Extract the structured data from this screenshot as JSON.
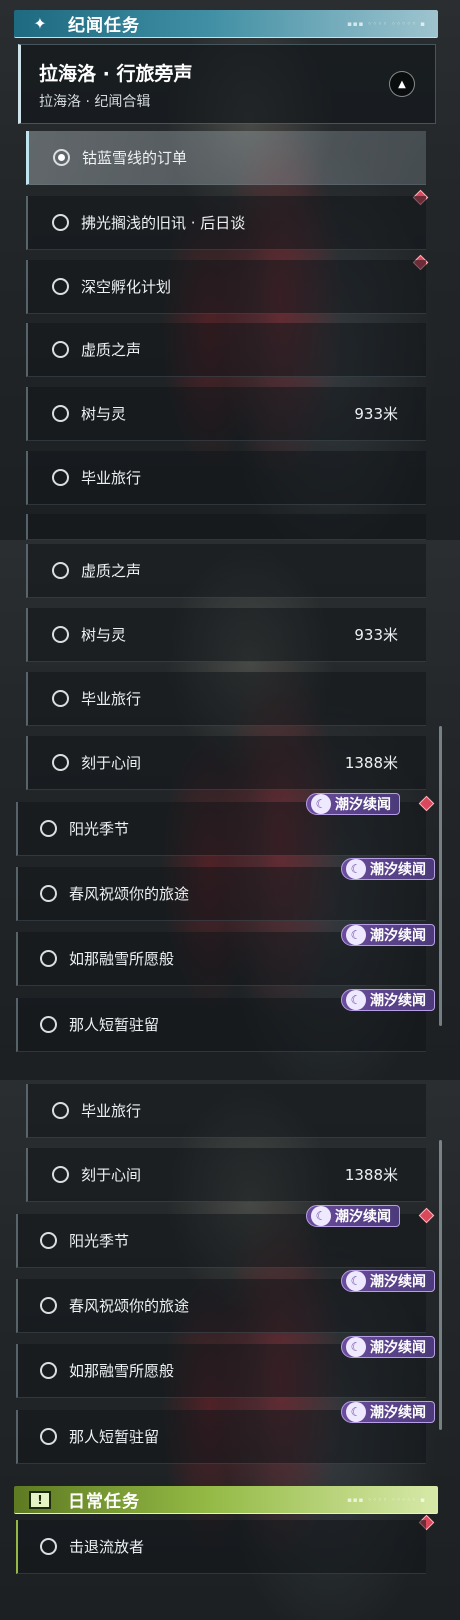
{
  "story_header": {
    "title": "纪闻任务",
    "icon": "sparkle-icon",
    "deco": "▪▪▪ ◦◦◦◦ ◦◦◦◦◦ ▪"
  },
  "daily_header": {
    "title": "日常任务",
    "icon": "exclamation-icon",
    "deco": "▪▪▪ ◦◦◦◦ ◦◦◦◦◦ ▪"
  },
  "group": {
    "title": "拉海洛 · 行旅旁声",
    "subtitle": "拉海洛 · 纪闻合辑",
    "collapse_icon": "chevron-up-icon"
  },
  "quests": {
    "q1": "钴蓝雪线的订单",
    "q2": "拂光搁浅的旧讯 · 后日谈",
    "q3": "深空孵化计划",
    "q4": "虚质之声",
    "q5": "树与灵",
    "q6": "毕业旅行",
    "q7": "刻于心间",
    "q8": "阳光季节",
    "q9": "春风祝颂你的旅途",
    "q10": "如那融雪所愿般",
    "q11": "那人短暂驻留",
    "daily1": "击退流放者"
  },
  "distances": {
    "q5": "933米",
    "q7": "1388米"
  },
  "badge_label": "潮汐续闻",
  "colors": {
    "story_accent": "#3f8ea3",
    "daily_accent": "#93b944",
    "badge": "#6a4c9c",
    "new_marker": "#d9485b"
  }
}
